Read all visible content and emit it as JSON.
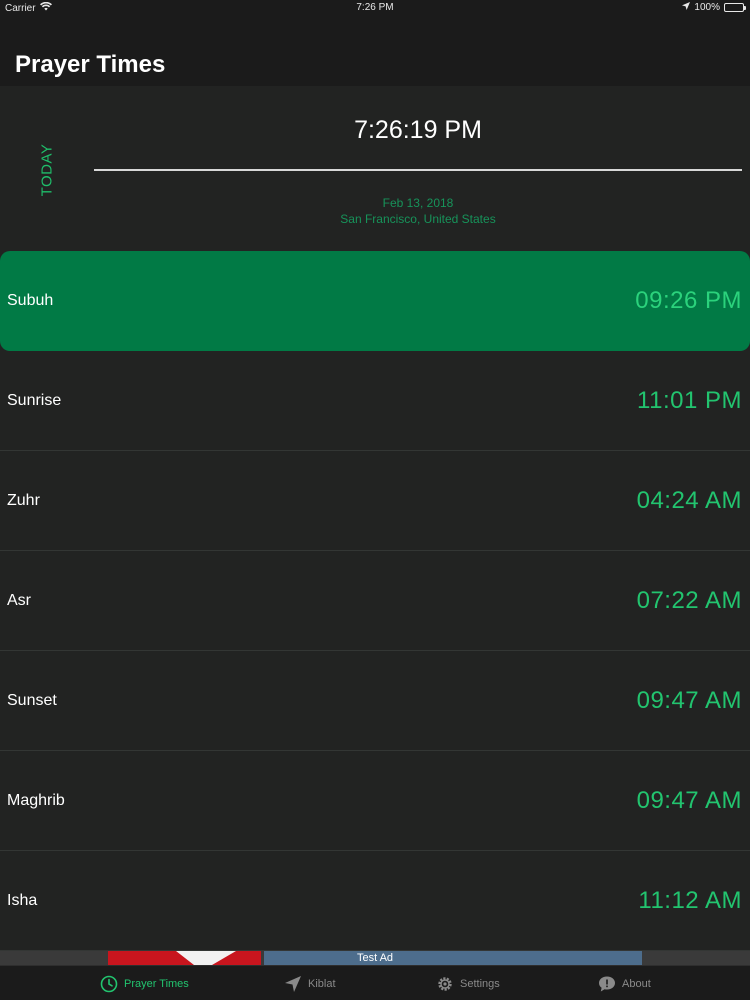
{
  "status_bar": {
    "carrier": "Carrier",
    "time": "7:26 PM",
    "battery": "100%",
    "battery_level": 1.0
  },
  "header": {
    "title": "Prayer Times",
    "today_label": "TODAY",
    "clock": "7:26:19 PM",
    "date": "Feb 13, 2018",
    "location": "San Francisco, United States"
  },
  "prayers": [
    {
      "name": "Subuh",
      "time": "09:26 PM",
      "active": true
    },
    {
      "name": "Sunrise",
      "time": "11:01 PM",
      "active": false
    },
    {
      "name": "Zuhr",
      "time": "04:24 AM",
      "active": false
    },
    {
      "name": "Asr",
      "time": "07:22 AM",
      "active": false
    },
    {
      "name": "Sunset",
      "time": "09:47 AM",
      "active": false
    },
    {
      "name": "Maghrib",
      "time": "09:47 AM",
      "active": false
    },
    {
      "name": "Isha",
      "time": "11:12 AM",
      "active": false
    }
  ],
  "ad": {
    "label": "Test Ad"
  },
  "tabs": [
    {
      "label": "Prayer Times",
      "icon": "clock-icon",
      "selected": true
    },
    {
      "label": "Kiblat",
      "icon": "location-arrow-icon",
      "selected": false
    },
    {
      "label": "Settings",
      "icon": "gear-icon",
      "selected": false
    },
    {
      "label": "About",
      "icon": "speech-bubble-icon",
      "selected": false
    }
  ],
  "colors": {
    "accent": "#22c46f",
    "active_row": "#017a45",
    "background": "#222322",
    "bar": "#1b1b1b"
  }
}
